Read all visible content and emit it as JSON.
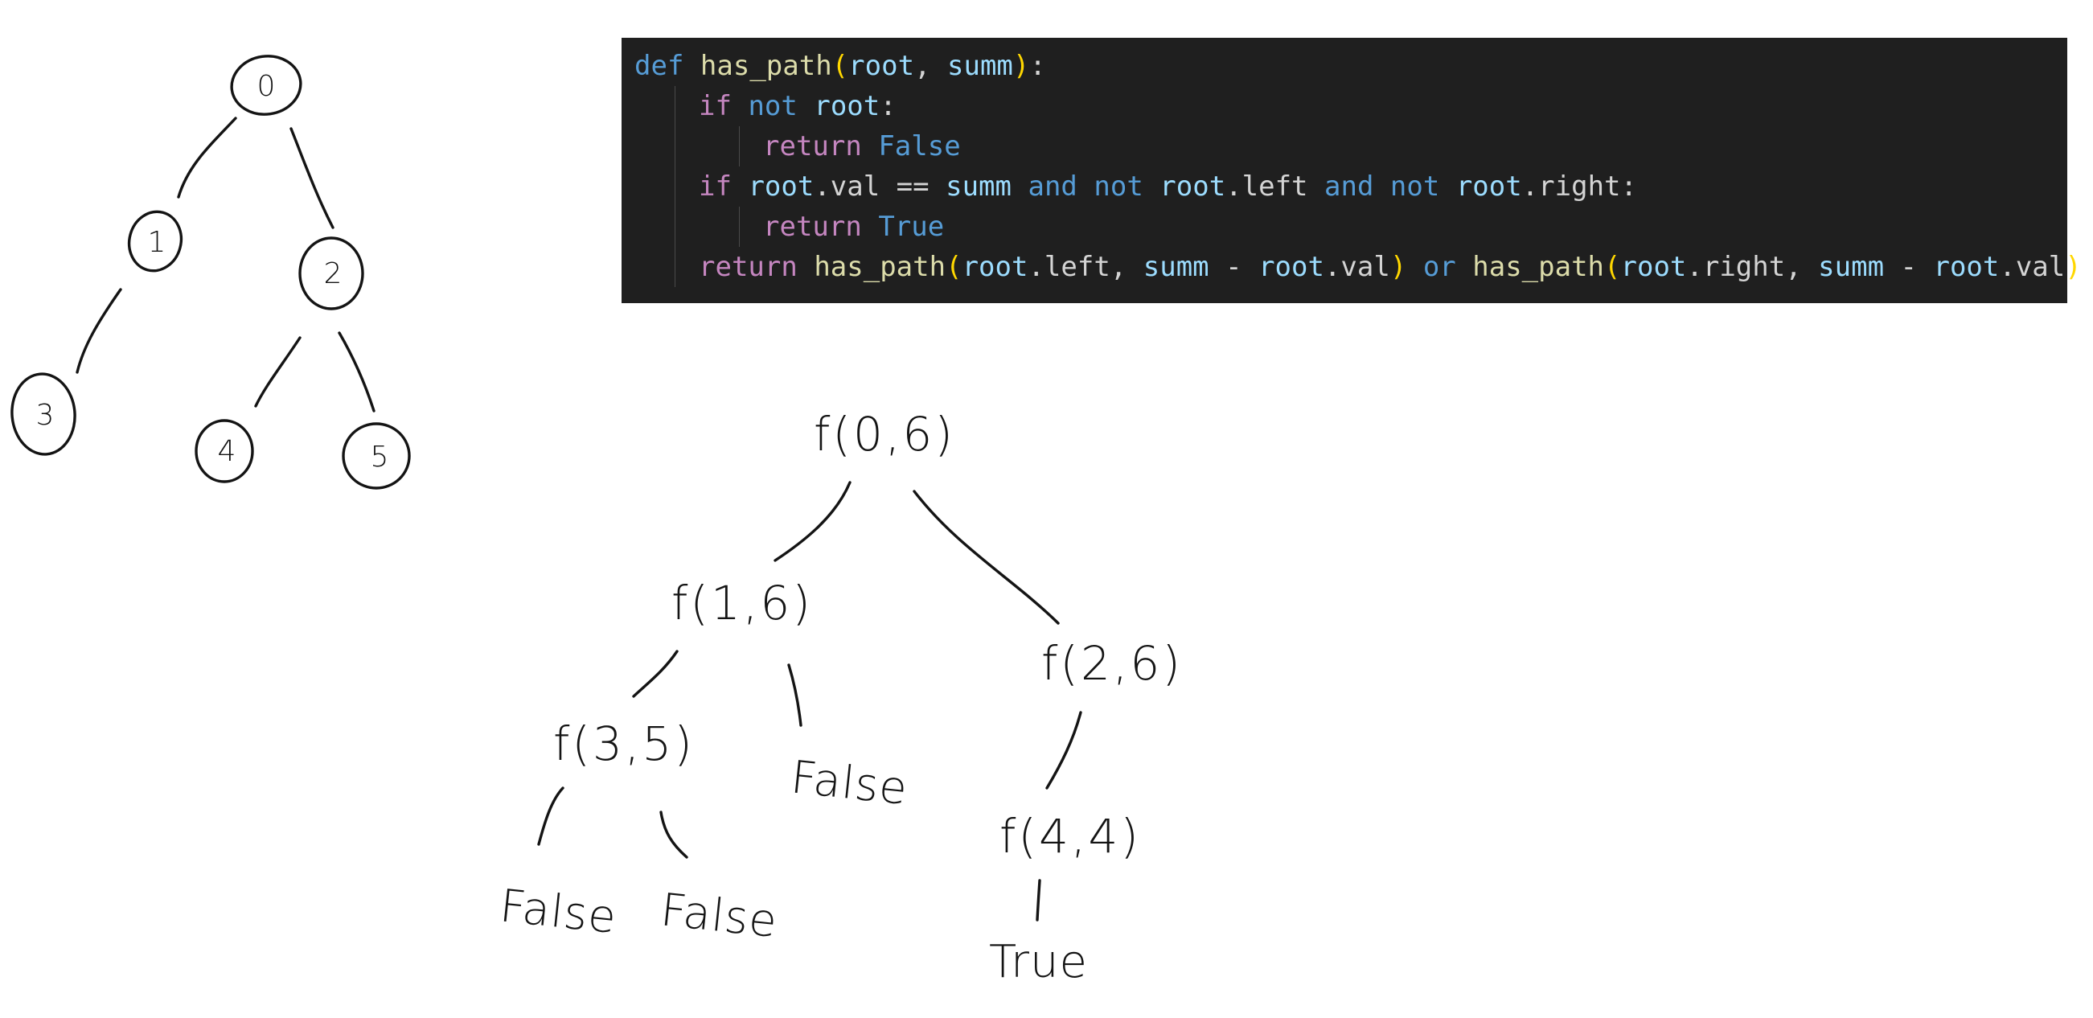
{
  "code": {
    "lines": [
      {
        "indent": 0,
        "tokens": [
          {
            "t": "def",
            "k": "keyword"
          },
          {
            "t": " ",
            "k": "plain"
          },
          {
            "t": "has_path",
            "k": "func"
          },
          {
            "t": "(",
            "k": "bracket"
          },
          {
            "t": "root",
            "k": "param"
          },
          {
            "t": ", ",
            "k": "plain"
          },
          {
            "t": "summ",
            "k": "param"
          },
          {
            "t": ")",
            "k": "bracket"
          },
          {
            "t": ":",
            "k": "plain"
          }
        ]
      },
      {
        "indent": 1,
        "tokens": [
          {
            "t": "if",
            "k": "control"
          },
          {
            "t": " ",
            "k": "plain"
          },
          {
            "t": "not",
            "k": "keyword"
          },
          {
            "t": " ",
            "k": "plain"
          },
          {
            "t": "root",
            "k": "param"
          },
          {
            "t": ":",
            "k": "plain"
          }
        ]
      },
      {
        "indent": 2,
        "tokens": [
          {
            "t": "return",
            "k": "control"
          },
          {
            "t": " ",
            "k": "plain"
          },
          {
            "t": "False",
            "k": "const"
          }
        ]
      },
      {
        "indent": 1,
        "tokens": [
          {
            "t": "if",
            "k": "control"
          },
          {
            "t": " ",
            "k": "plain"
          },
          {
            "t": "root",
            "k": "param"
          },
          {
            "t": ".val == ",
            "k": "plain"
          },
          {
            "t": "summ",
            "k": "param"
          },
          {
            "t": " ",
            "k": "plain"
          },
          {
            "t": "and",
            "k": "keyword"
          },
          {
            "t": " ",
            "k": "plain"
          },
          {
            "t": "not",
            "k": "keyword"
          },
          {
            "t": " ",
            "k": "plain"
          },
          {
            "t": "root",
            "k": "param"
          },
          {
            "t": ".left ",
            "k": "plain"
          },
          {
            "t": "and",
            "k": "keyword"
          },
          {
            "t": " ",
            "k": "plain"
          },
          {
            "t": "not",
            "k": "keyword"
          },
          {
            "t": " ",
            "k": "plain"
          },
          {
            "t": "root",
            "k": "param"
          },
          {
            "t": ".right:",
            "k": "plain"
          }
        ]
      },
      {
        "indent": 2,
        "tokens": [
          {
            "t": "return",
            "k": "control"
          },
          {
            "t": " ",
            "k": "plain"
          },
          {
            "t": "True",
            "k": "const"
          }
        ]
      },
      {
        "indent": 1,
        "tokens": [
          {
            "t": "return",
            "k": "control"
          },
          {
            "t": " ",
            "k": "plain"
          },
          {
            "t": "has_path",
            "k": "func"
          },
          {
            "t": "(",
            "k": "bracket"
          },
          {
            "t": "root",
            "k": "param"
          },
          {
            "t": ".left, ",
            "k": "plain"
          },
          {
            "t": "summ",
            "k": "param"
          },
          {
            "t": " - ",
            "k": "plain"
          },
          {
            "t": "root",
            "k": "param"
          },
          {
            "t": ".val",
            "k": "plain"
          },
          {
            "t": ")",
            "k": "bracket"
          },
          {
            "t": " ",
            "k": "plain"
          },
          {
            "t": "or",
            "k": "keyword"
          },
          {
            "t": " ",
            "k": "plain"
          },
          {
            "t": "has_path",
            "k": "func"
          },
          {
            "t": "(",
            "k": "bracket"
          },
          {
            "t": "root",
            "k": "param"
          },
          {
            "t": ".right, ",
            "k": "plain"
          },
          {
            "t": "summ",
            "k": "param"
          },
          {
            "t": " - ",
            "k": "plain"
          },
          {
            "t": "root",
            "k": "param"
          },
          {
            "t": ".val",
            "k": "plain"
          },
          {
            "t": ")",
            "k": "bracket"
          }
        ]
      }
    ]
  },
  "binary_tree": {
    "nodes": [
      "0",
      "1",
      "2",
      "3",
      "4",
      "5"
    ]
  },
  "recursion_tree": {
    "calls": [
      "f(0,6)",
      "f(1,6)",
      "f(2,6)",
      "f(3,5)",
      "f(4,4)"
    ],
    "leaves": [
      "False",
      "False",
      "False",
      "True"
    ]
  }
}
